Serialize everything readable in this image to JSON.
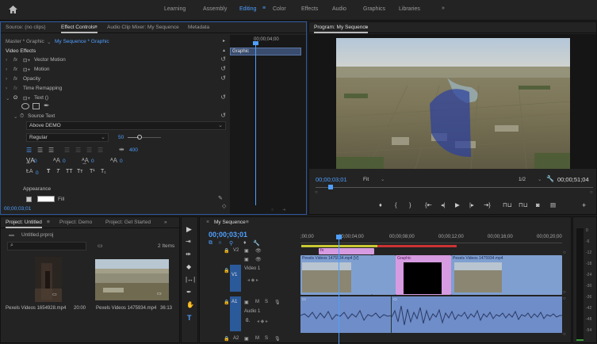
{
  "workspaces": [
    "Learning",
    "Assembly",
    "Editing",
    "Color",
    "Effects",
    "Audio",
    "Graphics",
    "Libraries"
  ],
  "workspace_active": "Editing",
  "workspace_more": "»",
  "source": {
    "tabs": [
      "Source: (no clips)",
      "Effect Controls",
      "Audio Clip Mixer: My Sequence",
      "Metadata"
    ],
    "tab_menu": "≡",
    "master": "Master * Graphic",
    "sequence": "My Sequence * Graphic",
    "timecode_top": "00;00;04;00",
    "clip_label": "Graphic",
    "video_effects": "Video Effects",
    "effects": [
      "Vector Motion",
      "Motion",
      "Opacity",
      "Time Remapping",
      "Text ()"
    ],
    "source_text": "Source Text",
    "text_value": "Above DEMO",
    "font_style": "Regular",
    "font_size": "50",
    "tracking": "400",
    "values_row": [
      "0",
      "0",
      "0",
      "0"
    ],
    "leading": "0",
    "appearance": "Appearance",
    "fill": "Fill",
    "timecode": "00;00;03;01"
  },
  "program": {
    "title": "Program: My Sequence",
    "menu": "≡",
    "timecode": "00;00;03;01",
    "fit": "Fit",
    "res": "1/2",
    "duration": "00;00;51;04"
  },
  "project": {
    "tabs": [
      "Project: Untitled",
      "Project: Demo",
      "Project: Get Started"
    ],
    "file": "Untitled.prproj",
    "items_count": "2 Items",
    "clips": [
      {
        "name": "Pexels Videos 1654928.mp4",
        "dur": "20:00"
      },
      {
        "name": "Pexels Videos 1475934.mp4",
        "dur": "36:13"
      }
    ]
  },
  "timeline": {
    "title": "My Sequence",
    "timecode": "00;00;03;01",
    "ruler": [
      ";00;00",
      "00;00;04;00",
      "00;00;08;00",
      "00;00;12;00",
      "00;00;16;00",
      "00;00;20;00"
    ],
    "v1_name": "Video 1",
    "a1_name": "Audio 1",
    "clips_v1": [
      "Pexels Videos 1475934.mp4 [V]",
      "Graphic",
      "Pexels Videos 1475934.mp4"
    ],
    "a1_value": "0.",
    "track_labels": [
      "V2",
      "V1",
      "A1",
      "A2"
    ]
  },
  "meter_scale": [
    "0",
    "-6",
    "-12",
    "-18",
    "-24",
    "-30",
    "-36",
    "-42",
    "-48",
    "-54"
  ]
}
